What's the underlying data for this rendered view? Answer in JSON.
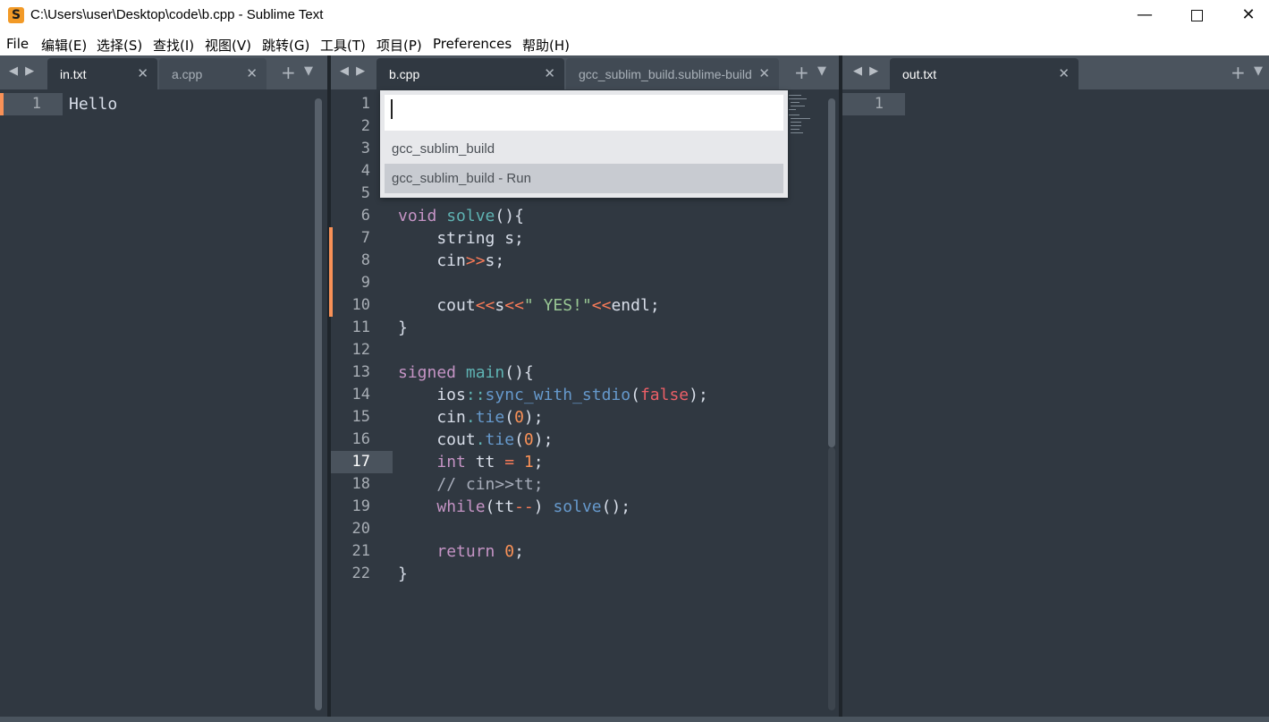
{
  "window": {
    "title": "C:\\Users\\user\\Desktop\\code\\b.cpp - Sublime Text",
    "icon": "sublime-logo-icon",
    "minimize": "—",
    "close": "✕"
  },
  "menu": [
    "File",
    "编辑(E)",
    "选择(S)",
    "查找(I)",
    "视图(V)",
    "跳转(G)",
    "工具(T)",
    "项目(P)",
    "Preferences",
    "帮助(H)"
  ],
  "groups": [
    {
      "tabs": [
        {
          "label": "in.txt",
          "active": true
        },
        {
          "label": "a.cpp",
          "active": false
        }
      ]
    },
    {
      "tabs": [
        {
          "label": "b.cpp",
          "active": true
        },
        {
          "label": "gcc_sublim_build.sublime-build",
          "active": false
        }
      ]
    },
    {
      "tabs": [
        {
          "label": "out.txt",
          "active": true
        }
      ]
    }
  ],
  "tab_controls": {
    "prev_next": "◀ ▶",
    "close": "✕",
    "new": "+",
    "menu": "▼"
  },
  "left_pane": {
    "lines": [
      "1"
    ],
    "code": [
      "Hello"
    ]
  },
  "right_pane": {
    "lines": [
      "1"
    ]
  },
  "middle_pane": {
    "line_numbers": [
      "1",
      "2",
      "3",
      "4",
      "5",
      "6",
      "7",
      "8",
      "9",
      "10",
      "11",
      "12",
      "13",
      "14",
      "15",
      "16",
      "17",
      "18",
      "19",
      "20",
      "21",
      "22"
    ],
    "current_line": "17"
  },
  "popup": {
    "input_value": "",
    "items": [
      {
        "label": "gcc_sublim_build",
        "selected": false
      },
      {
        "label": "gcc_sublim_build - Run",
        "selected": true
      }
    ]
  },
  "colors": {
    "editor_bg": "#303841",
    "accent_orange": "#f99157",
    "keyword": "#c594c5",
    "function": "#6699cc",
    "string": "#99c794"
  }
}
